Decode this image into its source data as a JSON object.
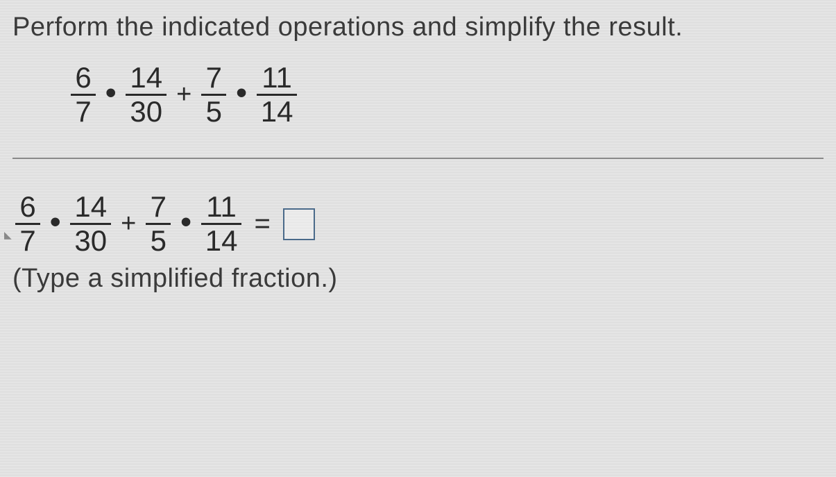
{
  "instruction": "Perform the indicated operations and simplify the result.",
  "expression": {
    "terms": [
      {
        "num": "6",
        "den": "7"
      },
      {
        "num": "14",
        "den": "30"
      },
      {
        "num": "7",
        "den": "5"
      },
      {
        "num": "11",
        "den": "14"
      }
    ],
    "ops": [
      "•",
      "+",
      "•"
    ]
  },
  "answer_line": {
    "terms": [
      {
        "num": "6",
        "den": "7"
      },
      {
        "num": "14",
        "den": "30"
      },
      {
        "num": "7",
        "den": "5"
      },
      {
        "num": "11",
        "den": "14"
      }
    ],
    "ops": [
      "•",
      "+",
      "•"
    ],
    "equals": "="
  },
  "hint": "(Type a simplified fraction.)"
}
